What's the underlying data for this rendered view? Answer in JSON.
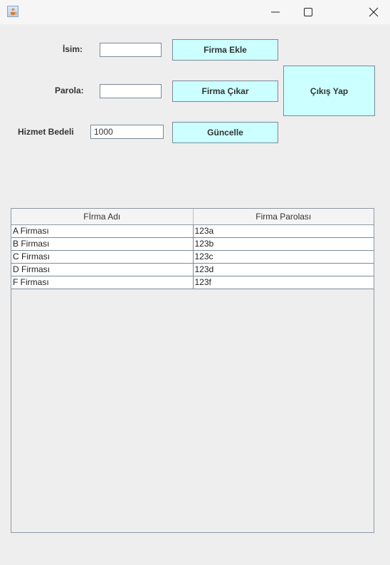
{
  "window": {
    "controls": {
      "minimize": "minimize",
      "maximize": "maximize",
      "close": "close"
    }
  },
  "form": {
    "name_label": "İsim:",
    "name_value": "",
    "password_label": "Parola:",
    "password_value": "",
    "fee_label": "Hizmet Bedeli",
    "fee_value": "1000"
  },
  "buttons": {
    "add": "Firma Ekle",
    "remove": "Firma Çıkar",
    "update": "Güncelle",
    "logout": "Çıkış Yap"
  },
  "table": {
    "columns": [
      "Fİrma Adı",
      "Firma Parolası"
    ],
    "rows": [
      [
        "A Firması",
        "123a"
      ],
      [
        "B Firması",
        "123b"
      ],
      [
        "C Firması",
        "123c"
      ],
      [
        "D Firması",
        "123d"
      ],
      [
        "F Firması",
        "123f"
      ]
    ]
  },
  "colors": {
    "button_bg": "#ccffff",
    "window_bg": "#eeeeee"
  }
}
